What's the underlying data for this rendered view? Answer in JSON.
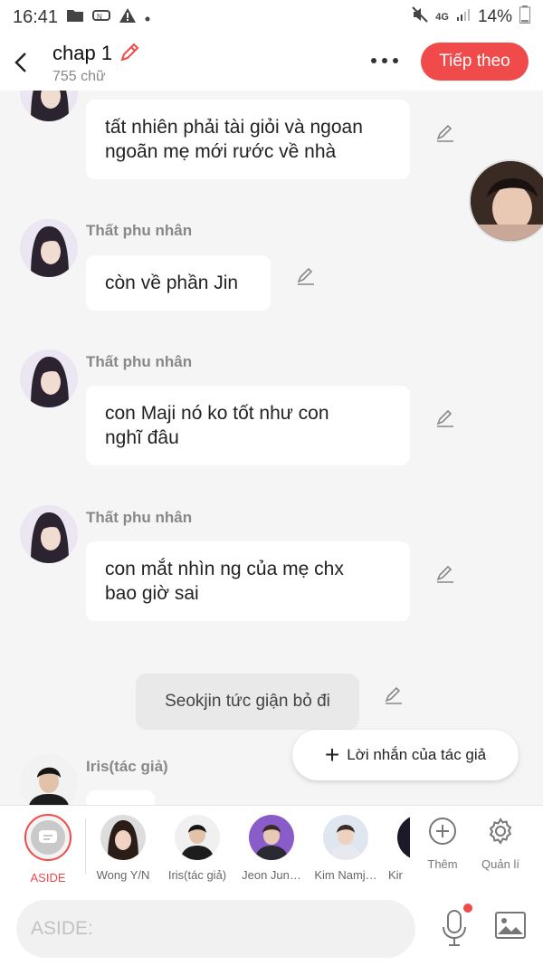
{
  "status": {
    "time": "16:41",
    "battery": "14%",
    "network": "4G"
  },
  "header": {
    "title": "chap 1",
    "word_count": "755 chữ",
    "next_label": "Tiếp theo"
  },
  "messages": [
    {
      "sender": "",
      "text_lines": [
        "tất nhiên phải tài giỏi và ngoan",
        "ngoãn mẹ mới rước về nhà"
      ]
    },
    {
      "sender": "Thất phu nhân",
      "text_lines": [
        "còn về phần Jin"
      ]
    },
    {
      "sender": "Thất phu nhân",
      "text_lines": [
        "con Maji nó ko tốt như con",
        "nghĩ đâu"
      ]
    },
    {
      "sender": "Thất phu nhân",
      "text_lines": [
        "con mắt nhìn ng của mẹ chx",
        "bao giờ sai"
      ]
    },
    {
      "sender": "Iris(tác giả)",
      "text_lines": []
    }
  ],
  "narration": {
    "text": "Seokjin tức giận bỏ đi"
  },
  "author_message_button": {
    "label": "Lời nhắn của tác giả"
  },
  "characters": {
    "aside_label": "ASIDE",
    "items": [
      {
        "name": "Wong Y/N"
      },
      {
        "name": "Iris(tác giả)"
      },
      {
        "name": "Jeon Jun…"
      },
      {
        "name": "Kim Namj…"
      },
      {
        "name": "Kir"
      }
    ],
    "add_label": "Thêm",
    "manage_label": "Quản lí"
  },
  "input": {
    "placeholder": "ASIDE:"
  },
  "colors": {
    "accent": "#f04a4a",
    "background": "#f5f5f5",
    "bubble": "#ffffff"
  }
}
